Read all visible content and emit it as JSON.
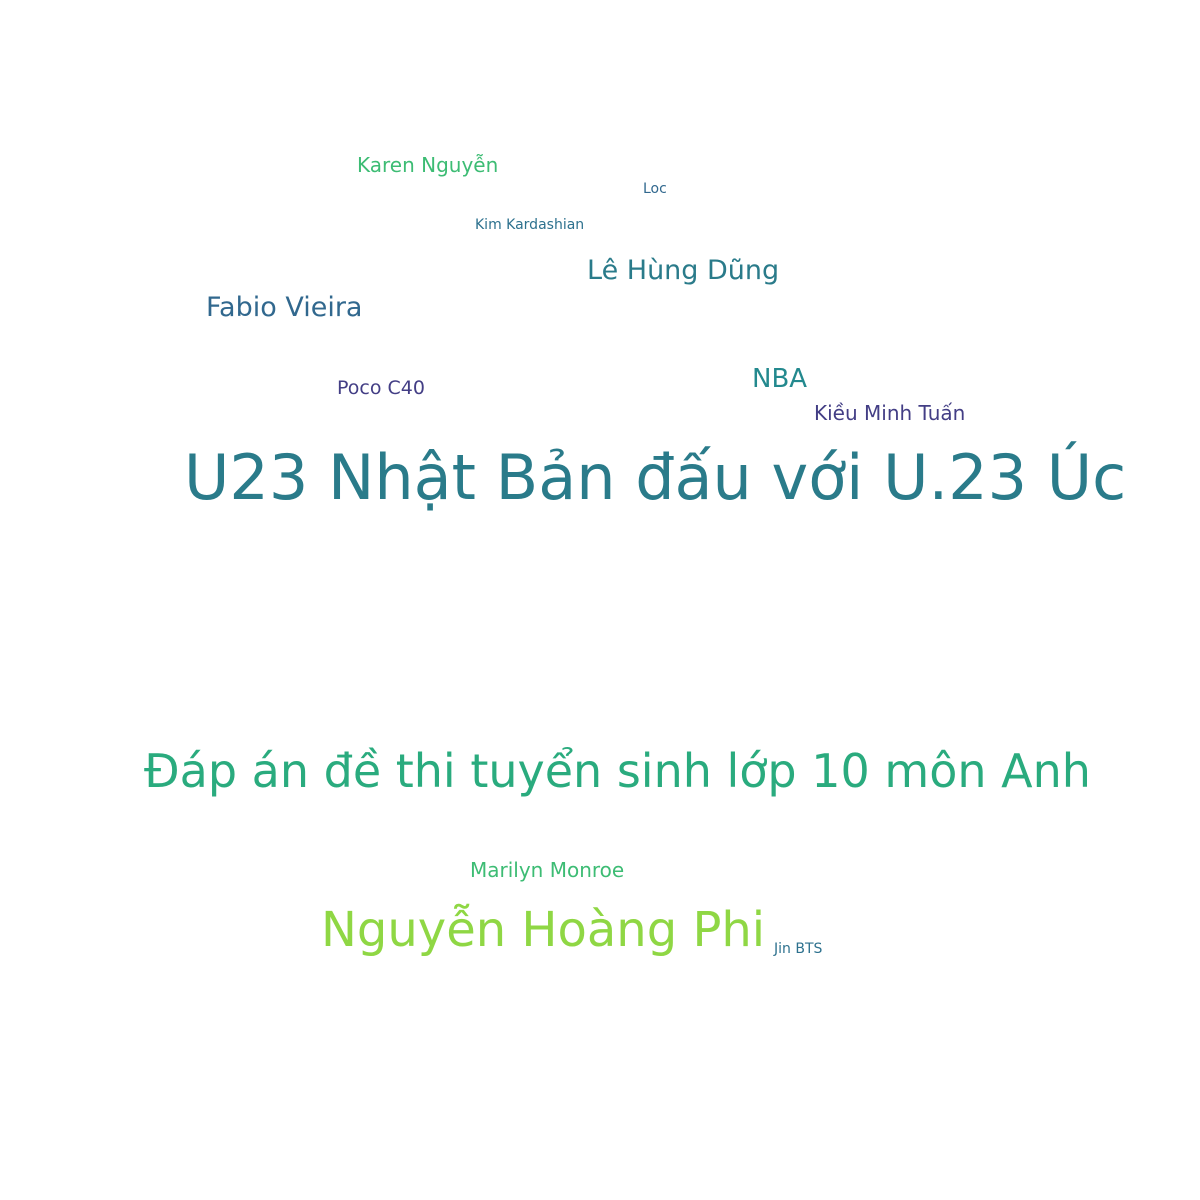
{
  "word_cloud": {
    "words": [
      {
        "id": "u23",
        "text": "U23 Nhật Bản đấu với U.23 Úc",
        "color": "#2a7b8a"
      },
      {
        "id": "dapan",
        "text": "Đáp án đề thi tuyển sinh lớp 10 môn Anh",
        "color": "#2aab7e"
      },
      {
        "id": "nhp",
        "text": "Nguyễn Hoàng Phi",
        "color": "#8fd744"
      },
      {
        "id": "lhd",
        "text": "Lê Hùng Dũng",
        "color": "#2a7b8a"
      },
      {
        "id": "fabio",
        "text": "Fabio Vieira",
        "color": "#31688e"
      },
      {
        "id": "nba",
        "text": "NBA",
        "color": "#23898e"
      },
      {
        "id": "karen",
        "text": "Karen Nguyễn",
        "color": "#3dbc74"
      },
      {
        "id": "marilyn",
        "text": "Marilyn Monroe",
        "color": "#3dbc74"
      },
      {
        "id": "kieu",
        "text": "Kiều Minh Tuấn",
        "color": "#433e85"
      },
      {
        "id": "poco",
        "text": "Poco C40",
        "color": "#433e85"
      },
      {
        "id": "kim",
        "text": "Kim Kardashian",
        "color": "#2d718e"
      },
      {
        "id": "loc",
        "text": "Loc",
        "color": "#31688e"
      },
      {
        "id": "jin",
        "text": "Jin BTS",
        "color": "#2d718e"
      }
    ]
  }
}
